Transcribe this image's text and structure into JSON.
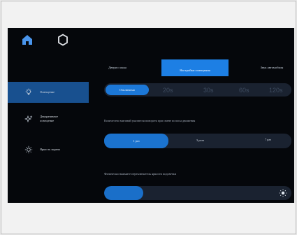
{
  "tabs": [
    {
      "label": "Двери и окна"
    },
    {
      "label": "Настройки освещения"
    },
    {
      "label": "Звук автомобиля"
    }
  ],
  "sidebar": {
    "items": [
      {
        "label": "Освещение",
        "icon": "bulb-icon",
        "active": true
      },
      {
        "label": "Декоративное освещение",
        "icon": "sparkle-icon",
        "active": false
      },
      {
        "label": "Яркость экрана",
        "icon": "sun-icon",
        "active": false
      }
    ]
  },
  "duration": {
    "selected": "Отключено",
    "options": [
      "20s",
      "30s",
      "60s",
      "120s"
    ]
  },
  "blink": {
    "caption": "Количество миганий указателя поворота при смене полосы движения",
    "options": [
      "1 раз",
      "3 раза",
      "7 раз"
    ],
    "selected_index": 0
  },
  "brightness": {
    "caption": "Физически нажмите переключатель яркости подсветки",
    "level_percent": 21
  },
  "colors": {
    "accent": "#1d7fe4",
    "active_sidebar": "#18508f",
    "background": "#05070b",
    "track": "#1a2230"
  }
}
